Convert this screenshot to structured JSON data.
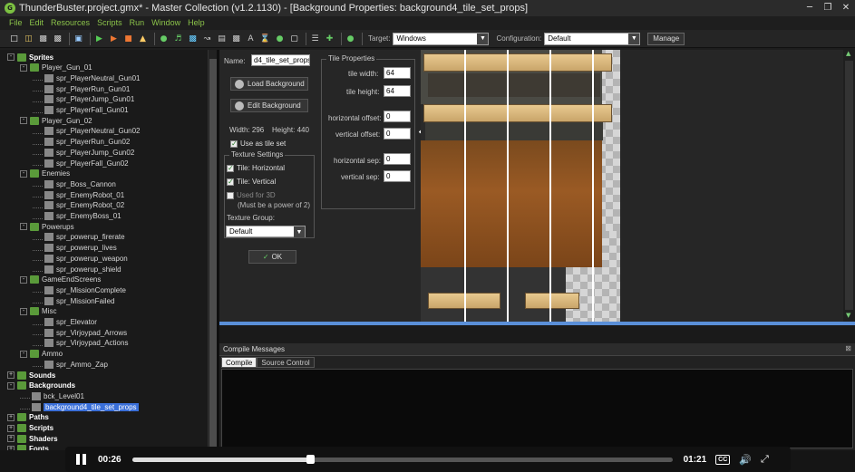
{
  "window": {
    "title": "ThunderBuster.project.gmx*  -  Master Collection (v1.2.1130) - [Background Properties: background4_tile_set_props]",
    "controls": [
      "minimize",
      "restore",
      "close"
    ]
  },
  "menu": [
    "File",
    "Edit",
    "Resources",
    "Scripts",
    "Run",
    "Window",
    "Help"
  ],
  "toolbar": {
    "target_label": "Target:",
    "target_value": "Windows",
    "config_label": "Configuration:",
    "config_value": "Default",
    "manage_label": "Manage"
  },
  "tree": {
    "items": [
      {
        "label": "Sprites",
        "level": 0,
        "kind": "folder",
        "bold": true,
        "expander": "-"
      },
      {
        "label": "Player_Gun_01",
        "level": 1,
        "kind": "folder",
        "expander": "-"
      },
      {
        "label": "spr_PlayerNeutral_Gun01",
        "level": 2,
        "kind": "sprite"
      },
      {
        "label": "spr_PlayerRun_Gun01",
        "level": 2,
        "kind": "sprite"
      },
      {
        "label": "spr_PlayerJump_Gun01",
        "level": 2,
        "kind": "sprite"
      },
      {
        "label": "spr_PlayerFall_Gun01",
        "level": 2,
        "kind": "sprite"
      },
      {
        "label": "Player_Gun_02",
        "level": 1,
        "kind": "folder",
        "expander": "-"
      },
      {
        "label": "spr_PlayerNeutral_Gun02",
        "level": 2,
        "kind": "sprite"
      },
      {
        "label": "spr_PlayerRun_Gun02",
        "level": 2,
        "kind": "sprite"
      },
      {
        "label": "spr_PlayerJump_Gun02",
        "level": 2,
        "kind": "sprite"
      },
      {
        "label": "spr_PlayerFall_Gun02",
        "level": 2,
        "kind": "sprite"
      },
      {
        "label": "Enemies",
        "level": 1,
        "kind": "folder",
        "expander": "-"
      },
      {
        "label": "spr_Boss_Cannon",
        "level": 2,
        "kind": "sprite"
      },
      {
        "label": "spr_EnemyRobot_01",
        "level": 2,
        "kind": "sprite"
      },
      {
        "label": "spr_EnemyRobot_02",
        "level": 2,
        "kind": "sprite"
      },
      {
        "label": "spr_EnemyBoss_01",
        "level": 2,
        "kind": "sprite"
      },
      {
        "label": "Powerups",
        "level": 1,
        "kind": "folder",
        "expander": "-"
      },
      {
        "label": "spr_powerup_firerate",
        "level": 2,
        "kind": "sprite"
      },
      {
        "label": "spr_powerup_lives",
        "level": 2,
        "kind": "sprite"
      },
      {
        "label": "spr_powerup_weapon",
        "level": 2,
        "kind": "sprite"
      },
      {
        "label": "spr_powerup_shield",
        "level": 2,
        "kind": "sprite"
      },
      {
        "label": "GameEndScreens",
        "level": 1,
        "kind": "folder",
        "expander": "-"
      },
      {
        "label": "spr_MissionComplete",
        "level": 2,
        "kind": "sprite"
      },
      {
        "label": "spr_MissionFailed",
        "level": 2,
        "kind": "sprite"
      },
      {
        "label": "Misc",
        "level": 1,
        "kind": "folder",
        "expander": "-"
      },
      {
        "label": "spr_Elevator",
        "level": 2,
        "kind": "sprite"
      },
      {
        "label": "spr_Virjoypad_Arrows",
        "level": 2,
        "kind": "sprite"
      },
      {
        "label": "spr_Virjoypad_Actions",
        "level": 2,
        "kind": "sprite"
      },
      {
        "label": "Ammo",
        "level": 1,
        "kind": "folder",
        "expander": "-"
      },
      {
        "label": "spr_Ammo_Zap",
        "level": 2,
        "kind": "sprite"
      },
      {
        "label": "Sounds",
        "level": 0,
        "kind": "folder",
        "bold": true,
        "expander": "+"
      },
      {
        "label": "Backgrounds",
        "level": 0,
        "kind": "folder",
        "bold": true,
        "expander": "-"
      },
      {
        "label": "bck_Level01",
        "level": 1,
        "kind": "sprite"
      },
      {
        "label": "background4_tile_set_props",
        "level": 1,
        "kind": "sprite",
        "selected": true
      },
      {
        "label": "Paths",
        "level": 0,
        "kind": "folder",
        "bold": true,
        "expander": "+"
      },
      {
        "label": "Scripts",
        "level": 0,
        "kind": "folder",
        "bold": true,
        "expander": "+"
      },
      {
        "label": "Shaders",
        "level": 0,
        "kind": "folder",
        "bold": true,
        "expander": "+"
      },
      {
        "label": "Fonts",
        "level": 0,
        "kind": "folder",
        "bold": true,
        "expander": "+"
      }
    ]
  },
  "props": {
    "name_label": "Name:",
    "name_value": "d4_tile_set_props",
    "load_button": "Load Background",
    "edit_button": "Edit Background",
    "width_text": "Width: 296",
    "height_text": "Height: 440",
    "use_tileset_label": "Use as tile set",
    "use_tileset_checked": true,
    "texture_settings_title": "Texture Settings",
    "tile_horizontal_label": "Tile: Horizontal",
    "tile_horizontal_checked": true,
    "tile_vertical_label": "Tile: Vertical",
    "tile_vertical_checked": true,
    "used_3d_label": "Used for 3D",
    "used_3d_note": "(Must be a power of 2)",
    "used_3d_checked": false,
    "texture_group_label": "Texture Group:",
    "texture_group_value": "Default",
    "ok_button": "OK"
  },
  "tile_properties": {
    "title": "Tile Properties",
    "tile_width_label": "tile width:",
    "tile_width_value": "64",
    "tile_height_label": "tile height:",
    "tile_height_value": "64",
    "h_offset_label": "horizontal offset:",
    "h_offset_value": "0",
    "v_offset_label": "vertical offset:",
    "v_offset_value": "0",
    "h_sep_label": "horizontal sep:",
    "h_sep_value": "0",
    "v_sep_label": "vertical sep:",
    "v_sep_value": "0"
  },
  "compile": {
    "title": "Compile Messages",
    "tabs": [
      "Compile",
      "Source Control"
    ],
    "active_tab": "Compile"
  },
  "video": {
    "current_time": "00:26",
    "total_time": "01:21",
    "progress": 0.33,
    "cc_label": "CC"
  },
  "colors": {
    "accent_green": "#8bc34a",
    "selection_blue": "#3a6fd8",
    "splitter_blue": "#5a8fd8"
  }
}
